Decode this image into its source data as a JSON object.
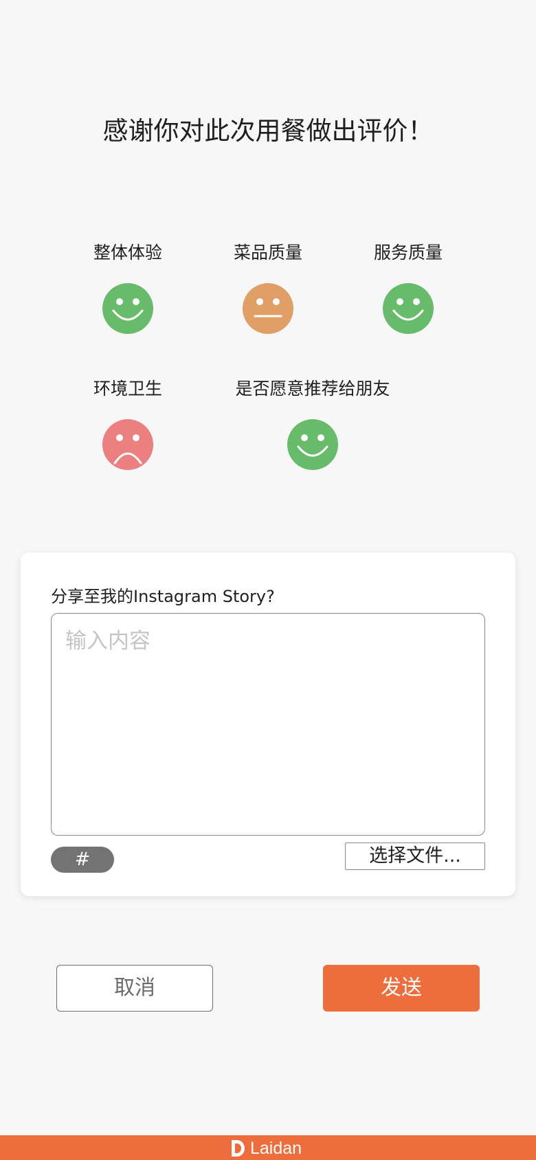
{
  "title": "感谢你对此次用餐做出评价！",
  "ratings": [
    {
      "label": "整体体验",
      "mood": "happy",
      "color": "#67bb6a"
    },
    {
      "label": "菜品质量",
      "mood": "neutral",
      "color": "#e0a065"
    },
    {
      "label": "服务质量",
      "mood": "happy",
      "color": "#67bb6a"
    },
    {
      "label": "环境卫生",
      "mood": "sad",
      "color": "#ec7f7f"
    },
    {
      "label": "是否愿意推荐给朋友",
      "mood": "happy",
      "color": "#67bb6a"
    }
  ],
  "share": {
    "question": "分享至我的Instagram Story?",
    "input_placeholder": "输入内容",
    "input_value": "",
    "hashtag_label": "#",
    "file_label": "选择文件..."
  },
  "buttons": {
    "cancel_label": "取消",
    "send_label": "发送"
  },
  "footer": {
    "brand": "Laidan",
    "logo_icon": "laidan-logo-icon"
  },
  "colors": {
    "accent": "#ee6d3c",
    "happy": "#67bb6a",
    "neutral": "#e0a065",
    "sad": "#ec7f7f"
  }
}
